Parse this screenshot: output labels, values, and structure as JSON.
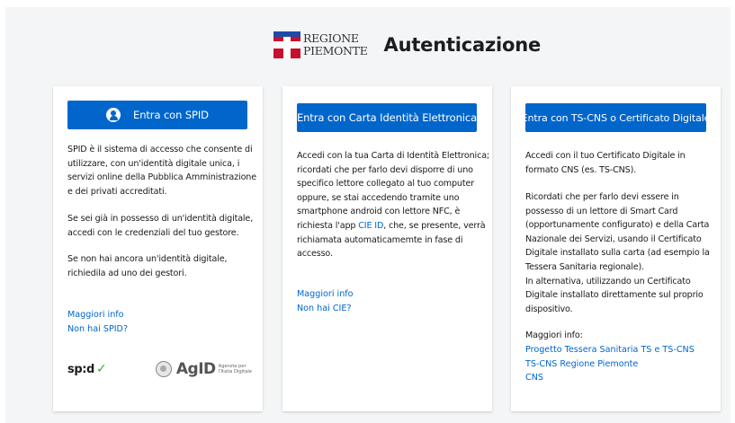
{
  "header": {
    "logo_line1": "REGIONE",
    "logo_line2": "PIEMONTE",
    "title": "Autenticazione"
  },
  "cards": [
    {
      "button_label": "Entra con SPID",
      "paragraphs": [
        "SPID è il sistema di accesso che consente di utilizzare, con un'identità digitale unica, i servizi online della Pubblica Amministrazione e dei privati accreditati.",
        "Se sei già in possesso di un'identità digitale, accedi con le credenziali del tuo gestore.",
        "Se non hai ancora un'identità digitale, richiedila ad uno dei gestori."
      ],
      "links": [
        "Maggiori info",
        "Non hai SPID?"
      ],
      "logos": {
        "spid": "sp:d",
        "agid_name": "AgID",
        "agid_sub1": "Agenzia per",
        "agid_sub2": "l'Italia Digitale"
      }
    },
    {
      "button_label": "Entra con Carta Identità Elettronica",
      "paragraph_before_link": "Accedi con la tua Carta di Identità Elettronica; ricordati che per farlo devi disporre di uno specifico lettore collegato al tuo computer oppure, se stai accedendo tramite uno smartphone android con lettore NFC, è richiesta l'app ",
      "inline_link": "CIE ID",
      "paragraph_after_link": ", che, se presente, verrà richiamata automaticamemte in fase di accesso.",
      "links": [
        "Maggiori info",
        "Non hai CIE?"
      ]
    },
    {
      "button_label": "Entra con TS-CNS o Certificato Digitale",
      "paragraphs": [
        "Accedi con il tuo Certificato Digitale in formato CNS (es. TS-CNS).",
        "Ricordati che per farlo devi essere in possesso di un lettore di Smart Card (opportunamente configurato) e della Carta Nazionale dei Servizi, usando il Certificato Digitale installato sulla carta (ad esempio la Tessera Sanitaria regionale).\nIn alternativa, utilizzando un Certificato Digitale installato direttamente sul proprio dispositivo.",
        "Maggiori info:"
      ],
      "links": [
        "Progetto Tessera Sanitaria TS e TS-CNS",
        "TS-CNS Regione Piemonte",
        "CNS"
      ]
    }
  ],
  "colors": {
    "primary": "#0066cc",
    "logo_red": "#c8102e",
    "spid_green": "#3aaa35",
    "page_bg": "#f4f5f6"
  }
}
